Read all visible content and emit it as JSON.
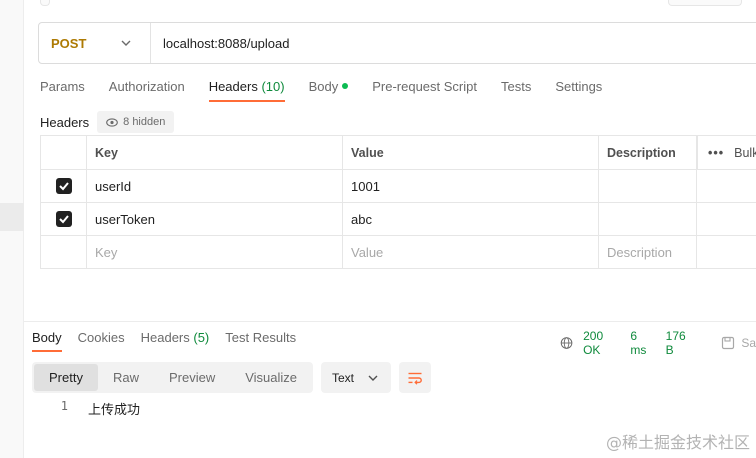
{
  "request": {
    "method": "POST",
    "url": "localhost:8088/upload"
  },
  "request_tabs": [
    {
      "label": "Params"
    },
    {
      "label": "Authorization"
    },
    {
      "label": "Headers",
      "count": "(10)"
    },
    {
      "label": "Body"
    },
    {
      "label": "Pre-request Script"
    },
    {
      "label": "Tests"
    },
    {
      "label": "Settings"
    }
  ],
  "headers_section": {
    "title": "Headers",
    "hidden_label": "8 hidden"
  },
  "headers_table": {
    "columns": {
      "key": "Key",
      "value": "Value",
      "description": "Description",
      "bulk": "Bulk"
    },
    "rows": [
      {
        "key": "userId",
        "value": "1001",
        "description": "",
        "checked": true
      },
      {
        "key": "userToken",
        "value": "abc",
        "description": "",
        "checked": true
      }
    ],
    "placeholders": {
      "key": "Key",
      "value": "Value",
      "description": "Description"
    }
  },
  "response_tabs": [
    {
      "label": "Body"
    },
    {
      "label": "Cookies"
    },
    {
      "label": "Headers",
      "count": "(5)"
    },
    {
      "label": "Test Results"
    }
  ],
  "response_status": {
    "status": "200 OK",
    "time": "6 ms",
    "size": "176 B",
    "save_label": "Sa"
  },
  "view_modes": [
    "Pretty",
    "Raw",
    "Preview",
    "Visualize"
  ],
  "format": "Text",
  "response_body": {
    "line_number": "1",
    "text": "上传成功"
  },
  "watermark": "@稀土掘金技术社区",
  "colors": {
    "method": "#ad7a03",
    "active_tab_underline": "#ff6c37",
    "status_green": "#0f8a3c",
    "body_dot": "#0cbb52"
  }
}
